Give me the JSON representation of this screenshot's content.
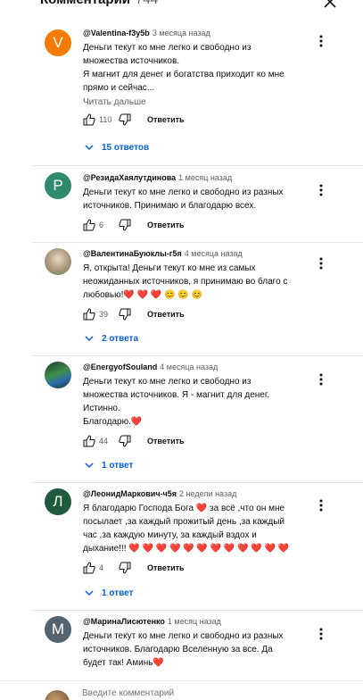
{
  "header": {
    "title": "Комментарии",
    "count": "744"
  },
  "comments": [
    {
      "avatar_letter": "V",
      "avatar_color": "#f57c00",
      "author": "@Valentina-f3y5b",
      "time": "3 месяца назад",
      "lines": [
        "Деньги текут ко мне легко и свободно из",
        "множества источников.",
        "Я магнит для денег и богатства приходит ко мне",
        "прямо и сейчас..."
      ],
      "read_more": "Читать дальше",
      "likes": "110",
      "reply": "Ответить",
      "replies": "15 ответов"
    },
    {
      "avatar_letter": "Р",
      "avatar_color": "#2e8b6e",
      "author": "@РезидаХаялутдинова",
      "time": "1 месяц назад",
      "lines": [
        "Деньги  текут  ко мне легко и свободно из разных",
        "источников. Принимаю и благодарю всех."
      ],
      "likes": "6",
      "reply": "Ответить"
    },
    {
      "avatar_letter": "",
      "avatar_color": "#b8a890",
      "author": "@ВалентинаБуюклы-г5я",
      "time": "4 месяца назад",
      "lines": [
        "Я, открыта! Деньги текут ко мне из самых",
        "неожиданных источников, я принимаю во благо с",
        "любовью!❤️ ❤️ ❤️ 😊 😊 😊"
      ],
      "likes": "39",
      "reply": "Ответить",
      "replies": "2 ответа"
    },
    {
      "avatar_letter": "",
      "avatar_color": "#2f6e3a",
      "author": "@EnergyofSouland",
      "time": "4 месяца назад",
      "lines": [
        "Деньги текут ко мне легко и свободно из",
        "множества источников. Я - магнит для денег.",
        "Истинно.",
        "Благодарю.❤️"
      ],
      "likes": "44",
      "reply": "Ответить",
      "replies": "1 ответ"
    },
    {
      "avatar_letter": "Л",
      "avatar_color": "#1f5a3c",
      "author": "@ЛеонидМаркович-ч5я",
      "time": "2 недели назад",
      "lines": [
        "Я благодарю Господа Бога ❤️  за всё ,что он мне",
        "посылает  ,за каждый прожитый день ,за каждый",
        "час ,за каждую минуту, за каждый вздох и",
        "дыхание!!! ❤️ ❤️ ❤️ ❤️ ❤️ ❤️ ❤️ ❤️ ❤️ ❤️ ❤️ ❤️"
      ],
      "likes": "4",
      "reply": "Ответить",
      "replies": "1 ответ"
    },
    {
      "avatar_letter": "М",
      "avatar_color": "#546370",
      "author": "@МаринаЛисютенко",
      "time": "1 месяц назад",
      "lines": [
        "Деньги текут ко мне легко и свободно из разных",
        "источников. Благодарю Вселенную за все. Да",
        "будет так! Аминь❤️"
      ]
    }
  ],
  "input": {
    "placeholder": "Введите комментарий"
  }
}
